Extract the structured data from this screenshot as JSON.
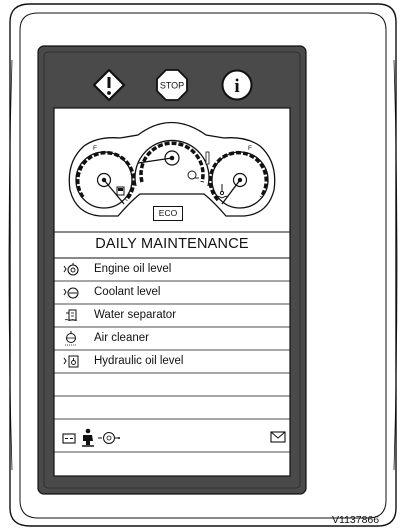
{
  "warning_icons": [
    {
      "name": "warning",
      "icon": "warning-diamond-icon"
    },
    {
      "name": "stop",
      "icon": "stop-octagon-icon",
      "label": "STOP"
    },
    {
      "name": "information",
      "icon": "info-circle-icon",
      "label": "i"
    }
  ],
  "gauges": {
    "fuel_mark": "F",
    "temperature_mark": "F",
    "eco_label": "ECO"
  },
  "panel": {
    "title": "DAILY MAINTENANCE",
    "items": [
      {
        "icon": "engine-oil-icon",
        "label": "Engine oil level"
      },
      {
        "icon": "coolant-icon",
        "label": "Coolant level"
      },
      {
        "icon": "water-separator-icon",
        "label": "Water separator"
      },
      {
        "icon": "air-cleaner-icon",
        "label": "Air cleaner"
      },
      {
        "icon": "hydraulic-oil-icon",
        "label": "Hydraulic oil level"
      }
    ]
  },
  "status_bar": {
    "icons": [
      "battery-icon",
      "operator-seat-icon",
      "engine-icon",
      "message-envelope-icon"
    ]
  },
  "reference_code": "V1137866"
}
